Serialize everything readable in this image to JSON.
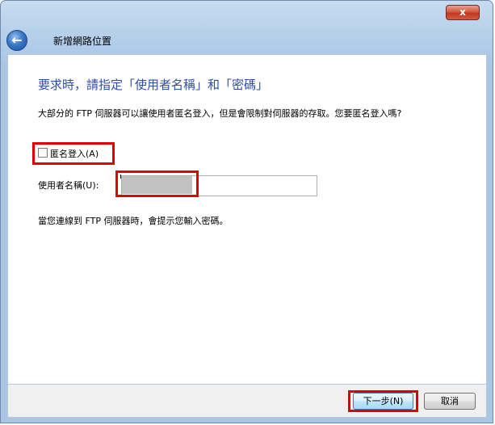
{
  "window": {
    "title": "新增網路位置",
    "close_glyph": "x",
    "back_glyph": "←"
  },
  "page": {
    "heading": "要求時，請指定「使用者名稱」和「密碼」",
    "description": "大部分的 FTP 伺服器可以讓使用者匿名登入，但是會限制對伺服器的存取。您要匿名登入嗎?",
    "anonymous_checkbox": {
      "label": "匿名登入(A)",
      "checked": false
    },
    "username": {
      "label": "使用者名稱(U):",
      "value": ""
    },
    "password_note": "當您連線到 FTP 伺服器時，會提示您輸入密碼。"
  },
  "footer": {
    "next_label": "下一步(N)",
    "cancel_label": "取消"
  },
  "colors": {
    "heading": "#2c4ea3",
    "highlight": "#e00000"
  }
}
